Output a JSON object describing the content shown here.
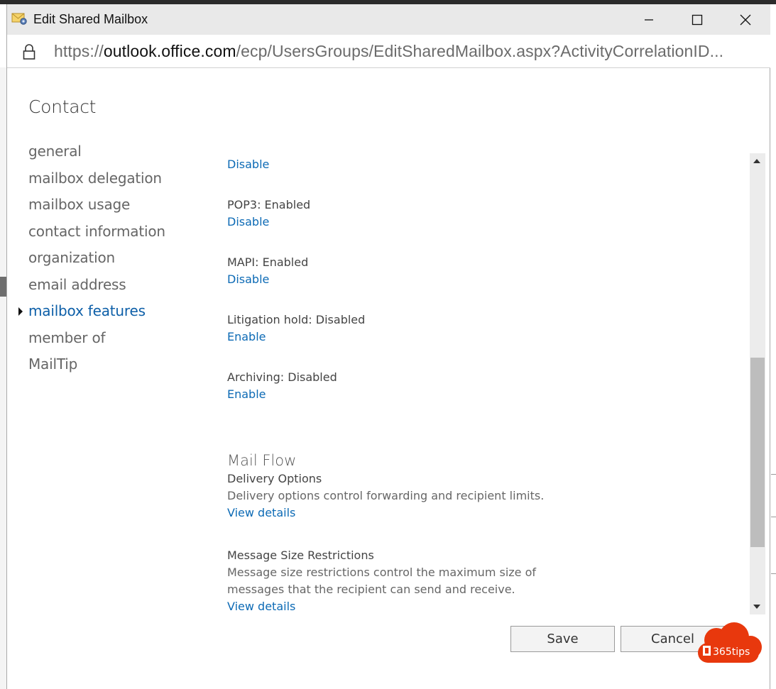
{
  "window": {
    "title": "Edit Shared Mailbox",
    "url_prefix": "https://",
    "url_domain": "outlook.office.com",
    "url_path": "/ecp/UsersGroups/EditSharedMailbox.aspx?ActivityCorrelationID..."
  },
  "page": {
    "heading": "Contact"
  },
  "nav": {
    "items": [
      {
        "label": "general"
      },
      {
        "label": "mailbox delegation"
      },
      {
        "label": "mailbox usage"
      },
      {
        "label": "contact information"
      },
      {
        "label": "organization"
      },
      {
        "label": "email address"
      },
      {
        "label": "mailbox features"
      },
      {
        "label": "member of"
      },
      {
        "label": "MailTip"
      }
    ],
    "active_index": 6
  },
  "features": {
    "top_link": "Disable",
    "pop3": {
      "label": "POP3: Enabled",
      "action": "Disable"
    },
    "mapi": {
      "label": "MAPI: Enabled",
      "action": "Disable"
    },
    "litigation": {
      "label": "Litigation hold: Disabled",
      "action": "Enable"
    },
    "archiving": {
      "label": "Archiving: Disabled",
      "action": "Enable"
    }
  },
  "mail_flow": {
    "title": "Mail Flow",
    "delivery": {
      "title": "Delivery Options",
      "description": "Delivery options control forwarding and recipient limits.",
      "link": "View details"
    },
    "size": {
      "title": "Message Size Restrictions",
      "description_line1": "Message size restrictions control the maximum size of",
      "description_line2": "messages that the recipient can send and receive.",
      "link": "View details"
    }
  },
  "buttons": {
    "save": "Save",
    "cancel": "Cancel"
  },
  "badge": {
    "text": "365tips"
  },
  "colors": {
    "link": "#0c6ab5",
    "active_nav": "#0d5fa8",
    "badge": "#e8380d"
  }
}
